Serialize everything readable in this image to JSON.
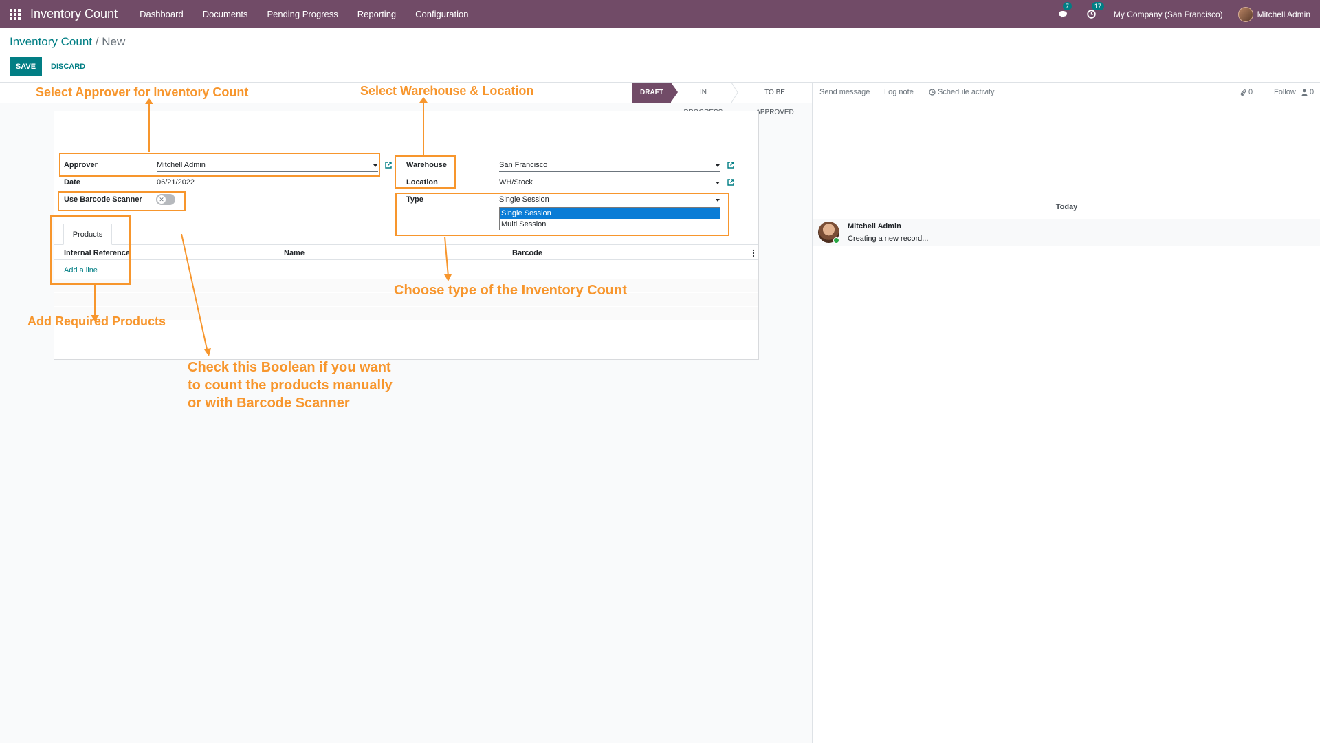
{
  "navbar": {
    "app_title": "Inventory Count",
    "menu": [
      "Dashboard",
      "Documents",
      "Pending Progress",
      "Reporting",
      "Configuration"
    ],
    "messages_count": "7",
    "activities_count": "17",
    "company": "My Company (San Francisco)",
    "user": "Mitchell Admin",
    "brand_color": "#714b67"
  },
  "breadcrumb": {
    "parent": "Inventory Count",
    "separator": "/",
    "current": "New"
  },
  "buttons": {
    "save": "SAVE",
    "discard": "DISCARD"
  },
  "statusbar": {
    "stages": [
      "DRAFT",
      "IN PROGRESS",
      "TO BE APPROVED"
    ],
    "active": "DRAFT"
  },
  "form": {
    "approver_label": "Approver",
    "approver_value": "Mitchell Admin",
    "date_label": "Date",
    "date_value": "06/21/2022",
    "barcode_label": "Use Barcode Scanner",
    "barcode_enabled": false,
    "warehouse_label": "Warehouse",
    "warehouse_value": "San Francisco",
    "location_label": "Location",
    "location_value": "WH/Stock",
    "type_label": "Type",
    "type_value": "Single Session",
    "type_options": [
      "Single Session",
      "Multi Session"
    ]
  },
  "products_tab": {
    "tab_label": "Products",
    "columns": [
      "Internal Reference",
      "Name",
      "Barcode"
    ],
    "add_line": "Add a line"
  },
  "annotations": {
    "approver": "Select Approver for Inventory Count",
    "warehouse": "Select Warehouse & Location",
    "type": "Choose type of the Inventory Count",
    "products": "Add Required Products",
    "barcode_line1": "Check this Boolean if you want",
    "barcode_line2": "to count the products manually",
    "barcode_line3": "or with Barcode Scanner",
    "color": "#f7962d"
  },
  "chatter": {
    "send_message": "Send message",
    "log_note": "Log note",
    "schedule_activity": "Schedule activity",
    "attachments_count": "0",
    "follow": "Follow",
    "followers_count": "0",
    "today": "Today",
    "message_author": "Mitchell Admin",
    "message_body": "Creating a new record..."
  }
}
